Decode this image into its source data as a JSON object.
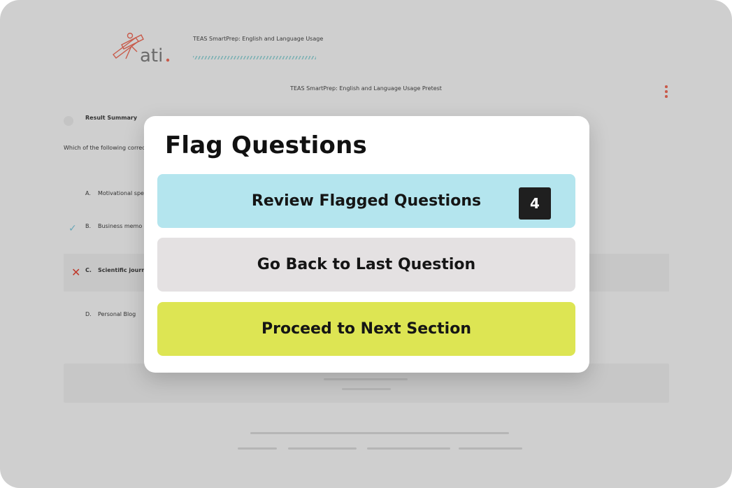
{
  "header": {
    "logo_text": "ati",
    "course_title": "TEAS SmartPrep: English and Language Usage",
    "pretest_title": "TEAS SmartPrep: English and Language Usage Pretest",
    "menu_icon": "kebab-menu-icon"
  },
  "question": {
    "summary_label": "Result Summary",
    "prompt": "Which of the following correctly",
    "answers": [
      {
        "letter": "A.",
        "text": "Motivational spee",
        "status": "none"
      },
      {
        "letter": "B.",
        "text": "Business memo",
        "status": "correct"
      },
      {
        "letter": "C.",
        "text": "Scientific journal",
        "status": "incorrect"
      },
      {
        "letter": "D.",
        "text": "Personal Blog",
        "status": "none"
      }
    ],
    "correct_icon": "checkmark-icon",
    "incorrect_icon": "x-mark-icon"
  },
  "modal": {
    "title": "Flag Questions",
    "review_label": "Review Flagged Questions",
    "flagged_count": "4",
    "back_label": "Go Back to Last Question",
    "next_label": "Proceed to Next Section"
  },
  "colors": {
    "review_button": "#b4e5ee",
    "back_button": "#e4e1e2",
    "next_button": "#dde553",
    "badge": "#1f1f1f",
    "correct_mark": "#6aa7b8",
    "incorrect_mark": "#c0392b",
    "brand_red": "#c85a4a"
  }
}
